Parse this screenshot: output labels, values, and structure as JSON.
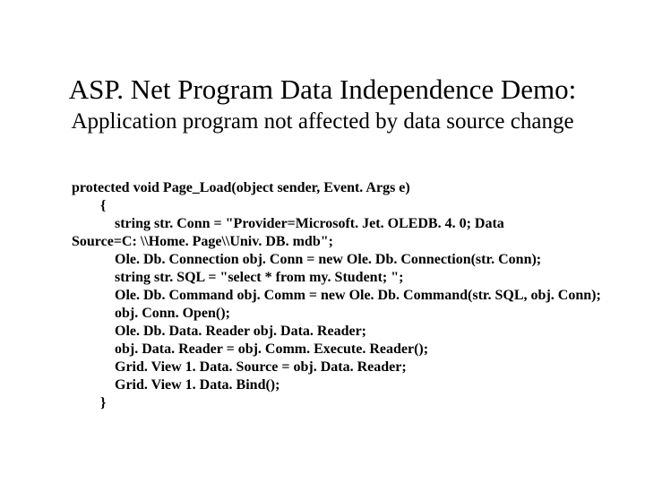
{
  "title": "ASP. Net Program Data Independence Demo:",
  "subtitle": "Application program not affected by data source change",
  "code": {
    "sig": "protected void Page_Load(object sender, Event. Args e)",
    "open": "        {",
    "l1": "            string str. Conn = \"Provider=Microsoft. Jet. OLEDB. 4. 0; Data",
    "l1b": "Source=C: \\\\Home. Page\\\\Univ. DB. mdb\";",
    "l2": "            Ole. Db. Connection obj. Conn = new Ole. Db. Connection(str. Conn);",
    "l3": "            string str. SQL = \"select * from my. Student; \";",
    "l4": "            Ole. Db. Command obj. Comm = new Ole. Db. Command(str. SQL, obj. Conn);",
    "l5": "            obj. Conn. Open();",
    "l6": "            Ole. Db. Data. Reader obj. Data. Reader;",
    "l7": "            obj. Data. Reader = obj. Comm. Execute. Reader();",
    "l8": "            Grid. View 1. Data. Source = obj. Data. Reader;",
    "l9": "            Grid. View 1. Data. Bind();",
    "close": "        }"
  }
}
